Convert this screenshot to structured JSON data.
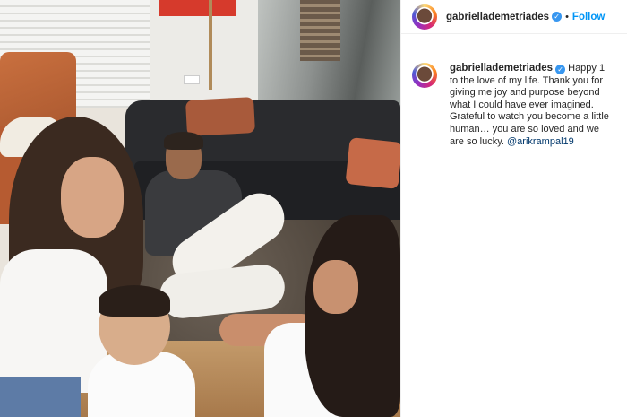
{
  "post": {
    "image_alt": "Family photo",
    "author": {
      "username": "gabrielladem​etriades",
      "verified_icon": "verified-badge-icon",
      "avatar_icon": "avatar"
    },
    "follow_label": "Follow",
    "separator": "•",
    "caption": {
      "username": "gabrielladem​etriades",
      "text": "Happy 1 to the love of my life. Thank you for giving me joy and purpose beyond what I could have ever imagined. Grateful to watch you become a little human… you are so loved and we are so lucky. ",
      "mention": "@arikrampal19"
    },
    "colors": {
      "follow": "#0095f6",
      "verified": "#3897f0",
      "mention": "#00376b"
    }
  }
}
